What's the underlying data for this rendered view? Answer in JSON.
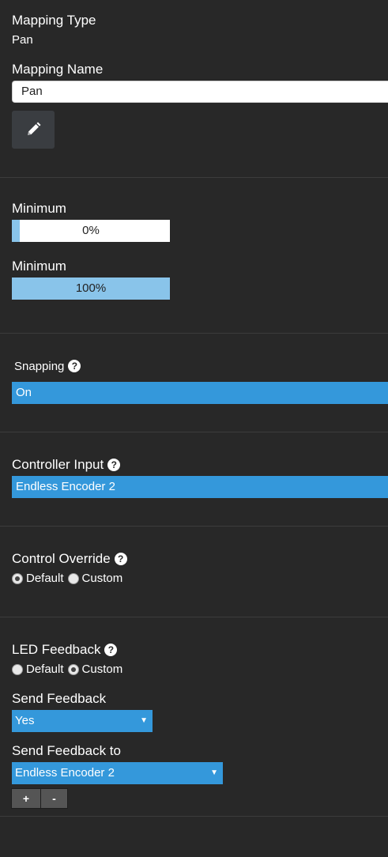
{
  "mapping_type": {
    "label": "Mapping Type",
    "value": "Pan"
  },
  "mapping_name": {
    "label": "Mapping Name",
    "value": "Pan"
  },
  "edit_button": {
    "icon": "pencil-icon"
  },
  "minimum_1": {
    "label": "Minimum",
    "value_text": "0%",
    "fill_fraction": 0.05
  },
  "minimum_2": {
    "label": "Minimum",
    "value_text": "100%",
    "fill_fraction": 1.0
  },
  "snapping": {
    "label": "Snapping",
    "help_glyph": "?",
    "value": "On"
  },
  "controller_input": {
    "label": "Controller Input",
    "help_glyph": "?",
    "value": "Endless Encoder 2"
  },
  "control_override": {
    "label": "Control Override",
    "help_glyph": "?",
    "options": [
      "Default",
      "Custom"
    ],
    "selected": "Default"
  },
  "led_feedback": {
    "label": "LED Feedback",
    "help_glyph": "?",
    "options": [
      "Default",
      "Custom"
    ],
    "selected": "Custom"
  },
  "send_feedback": {
    "label": "Send Feedback",
    "value": "Yes",
    "caret": "▼"
  },
  "send_feedback_to": {
    "label": "Send Feedback to",
    "value": "Endless Encoder 2",
    "caret": "▼"
  },
  "add_button": {
    "label": "+"
  },
  "remove_button": {
    "label": "-"
  },
  "colors": {
    "background": "#282828",
    "accent": "#3498db",
    "slider_fill": "#89c4ea"
  }
}
